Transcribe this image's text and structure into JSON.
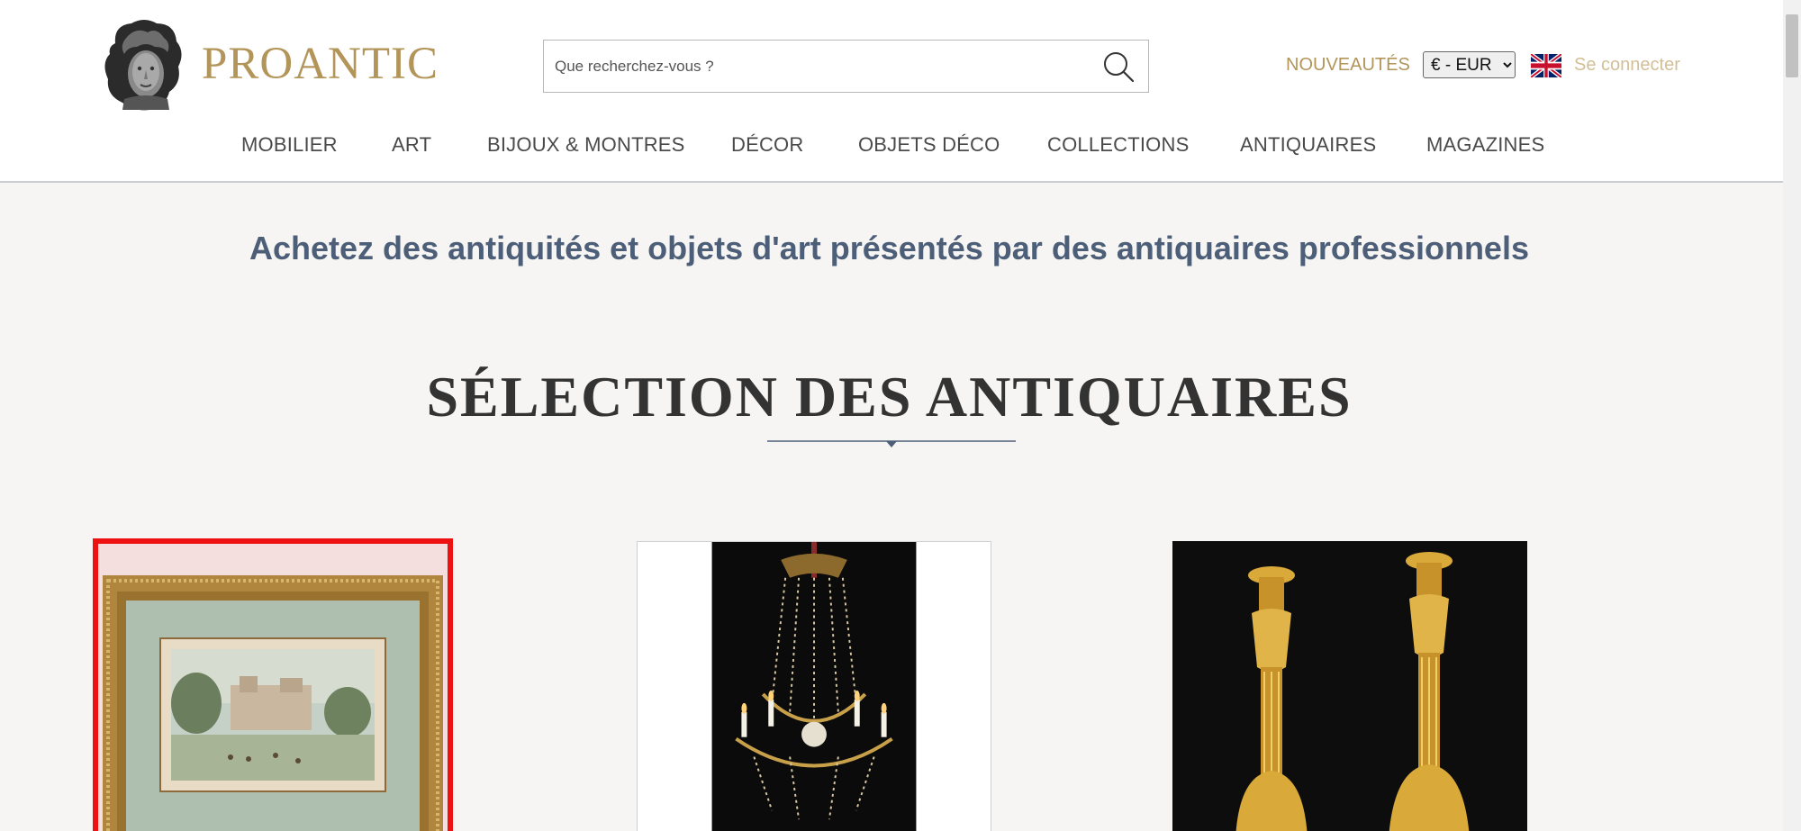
{
  "header": {
    "brand": "PROANTIC",
    "logo_icon": "bust-statue-logo-icon",
    "search": {
      "placeholder": "Que recherchez-vous ?",
      "value": "",
      "icon": "search-icon"
    },
    "nouveautes": "NOUVEAUTÉS",
    "currency": {
      "selected": "€ - EUR",
      "options": [
        "€ - EUR"
      ]
    },
    "language_icon": "uk-flag-icon",
    "login": "Se connecter"
  },
  "nav": {
    "items": [
      {
        "label": "MOBILIER"
      },
      {
        "label": "ART"
      },
      {
        "label": "BIJOUX & MONTRES"
      },
      {
        "label": "DÉCOR"
      },
      {
        "label": "OBJETS DÉCO"
      },
      {
        "label": "COLLECTIONS"
      },
      {
        "label": "ANTIQUAIRES"
      },
      {
        "label": "MAGAZINES"
      }
    ]
  },
  "main": {
    "tagline": "Achetez des antiquités et objets d'art présentés par des antiquaires professionnels",
    "section_title": "SÉLECTION DES ANTIQUAIRES",
    "products": [
      {
        "image": "framed-landscape-print"
      },
      {
        "image": "crystal-chandelier"
      },
      {
        "image": "gilt-bronze-candlesticks"
      }
    ]
  },
  "colors": {
    "brand_gold": "#b3955a",
    "login_gold": "#d2bf97",
    "tagline_blue": "#4d5e78",
    "page_background": "#f6f5f3",
    "selection_outline": "#ee1111"
  }
}
